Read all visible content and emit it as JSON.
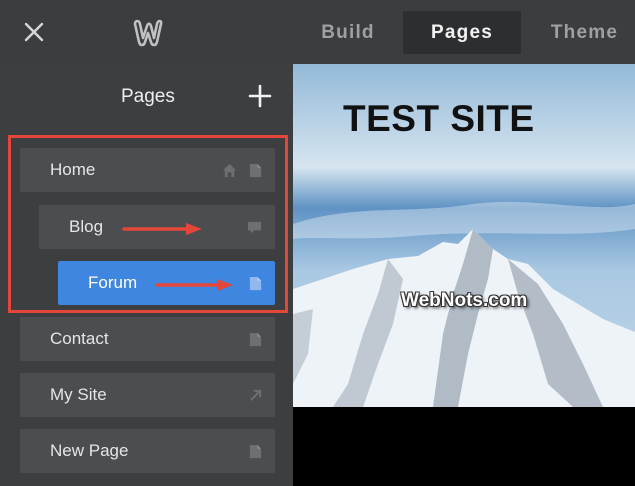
{
  "topbar": {
    "close_icon": "close-icon",
    "logo_icon": "weebly-logo-icon",
    "tabs": [
      {
        "label": "Build",
        "active": false
      },
      {
        "label": "Pages",
        "active": true
      },
      {
        "label": "Theme",
        "active": false
      }
    ]
  },
  "sidebar": {
    "title": "Pages",
    "add_icon": "plus-icon",
    "items": [
      {
        "label": "Home",
        "icons": [
          "home-icon",
          "page-icon"
        ],
        "selected": false
      },
      {
        "label": "Blog",
        "icons": [
          "comment-icon"
        ],
        "selected": false
      },
      {
        "label": "Forum",
        "icons": [
          "page-icon"
        ],
        "selected": true
      },
      {
        "label": "Contact",
        "icons": [
          "page-icon"
        ],
        "selected": false
      },
      {
        "label": "My Site",
        "icons": [
          "external-link-icon"
        ],
        "selected": false
      },
      {
        "label": "New Page",
        "icons": [
          "page-icon"
        ],
        "selected": false
      }
    ]
  },
  "annotations": {
    "highlight_color": "#e6463a",
    "arrow_color": "#e6463a"
  },
  "preview": {
    "site_title": "TEST SITE",
    "watermark": "WebNots.com"
  },
  "colors": {
    "topbar_bg": "#3b3d3f",
    "sidebar_bg": "#3c3e40",
    "item_bg": "#4b4d50",
    "selected_bg": "#3f86e0"
  }
}
